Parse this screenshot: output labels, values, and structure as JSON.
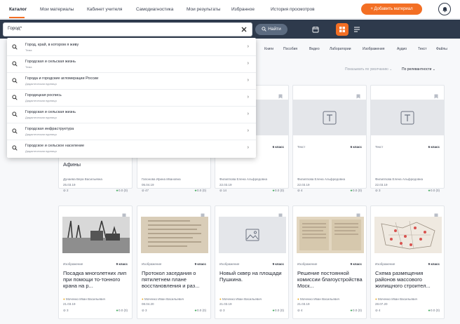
{
  "topnav": {
    "items": [
      "Каталог",
      "Мои материалы",
      "Кабинет учителя",
      "Самодиагностика",
      "Мои результаты",
      "Избранное",
      "История просмотров"
    ],
    "add_button": "+ Добавить материал",
    "accent": "#f36f24"
  },
  "search": {
    "value": "Город*",
    "button": "Найти"
  },
  "suggestions": [
    {
      "title": "Город, край, в котором я живу",
      "type": "Тема"
    },
    {
      "title": "Городская и сельская жизнь",
      "type": "Тема"
    },
    {
      "title": "Города и городские агломерации России",
      "type": "Дидактическая единица"
    },
    {
      "title": "Городецкая роспись",
      "type": "Дидактическая единица"
    },
    {
      "title": "Городская и сельская жизнь",
      "type": "Дидактическая единица"
    },
    {
      "title": "Городская инфраструктура",
      "type": "Дидактическая единица"
    },
    {
      "title": "Городское и сельское население",
      "type": "Дидактическая единица"
    }
  ],
  "filters": [
    "Книги",
    "Пособия",
    "Видео",
    "Лаборатории",
    "Изображения",
    "Аудио",
    "Текст",
    "Файлы"
  ],
  "sort": {
    "default_label": "Показывать по умолчанию ⌄",
    "relevance_label": "По релевантности ⌄"
  },
  "row1": [
    {
      "type": "",
      "klass": "",
      "title": "Афины",
      "author": "Дунаева Вера Васильевна",
      "date": "25.03.19",
      "downloads": "2",
      "rating": "0.0 (0)"
    },
    {
      "type": "",
      "klass": "",
      "title": "",
      "author": "Гапонова Ирина Ивановна",
      "date": "05.04.19",
      "downloads": "47",
      "rating": "0.0 (0)"
    },
    {
      "type": "",
      "klass": "6 класс",
      "title": "",
      "author": "Филиппова Елена Альфредовна",
      "date": "22.03.19",
      "downloads": "14",
      "rating": "0.0 (0)"
    },
    {
      "type": "Текст",
      "klass": "6 класс",
      "title": "",
      "author": "Филиппова Елена Альфредовна",
      "date": "22.03.19",
      "downloads": "4",
      "rating": "0.0 (0)"
    },
    {
      "type": "Текст",
      "klass": "6 класс",
      "title": "",
      "author": "Филиппова Елена Альфредовна",
      "date": "22.03.19",
      "downloads": "3",
      "rating": "0.0 (0)"
    }
  ],
  "row2": [
    {
      "type": "Изображение",
      "klass": "9 класс",
      "title": "Посадка многолетних лип при помощи то-тонного крана на р...",
      "author": "Моченко Иван Васильевич",
      "date": "21.03.19",
      "downloads": "3",
      "rating": "0.0 (0)"
    },
    {
      "type": "Изображение",
      "klass": "9 класс",
      "title": "Протокол заседания о пятилетнем плане восстановления и раз...",
      "author": "Моченко Иван Васильевич",
      "date": "08.04.20",
      "downloads": "3",
      "rating": "0.0 (0)"
    },
    {
      "type": "Изображение",
      "klass": "9 класс",
      "title": "Новый сквер на площади Пушкина.",
      "author": "Моченко Иван Васильевич",
      "date": "21.03.19",
      "downloads": "3",
      "rating": "0.0 (0)"
    },
    {
      "type": "Изображение",
      "klass": "9 класс",
      "title": "Решение постоянной комиссии благоустройства Моск...",
      "author": "Моченко Иван Васильевич",
      "date": "21.03.19",
      "downloads": "4",
      "rating": "0.0 (0)"
    },
    {
      "type": "Изображение",
      "klass": "9 класс",
      "title": "Схема размещения районов массового жилищного строител...",
      "author": "Моченко Иван Васильевич",
      "date": "28.07.20",
      "downloads": "4",
      "rating": "0.0 (0)"
    }
  ]
}
